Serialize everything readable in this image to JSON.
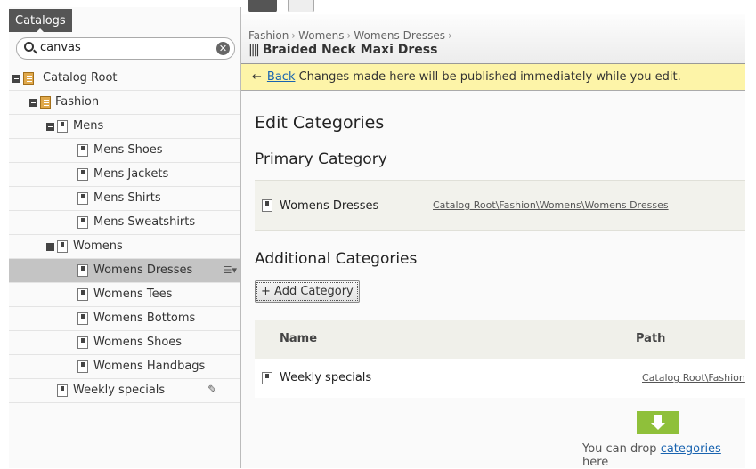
{
  "sidebar": {
    "tab": "Catalogs",
    "search": {
      "value": "canvas"
    },
    "tree": [
      {
        "label": "Catalog Root",
        "level": 0,
        "toggle": true,
        "icon": "catalog-book-icon"
      },
      {
        "label": "Fashion",
        "level": 1,
        "toggle": true,
        "icon": "catalog-book-icon"
      },
      {
        "label": "Mens",
        "level": 2,
        "toggle": true,
        "icon": "category-icon"
      },
      {
        "label": "Mens Shoes",
        "level": 3,
        "toggle": false,
        "icon": "category-icon"
      },
      {
        "label": "Mens Jackets",
        "level": 3,
        "toggle": false,
        "icon": "category-icon"
      },
      {
        "label": "Mens Shirts",
        "level": 3,
        "toggle": false,
        "icon": "category-icon"
      },
      {
        "label": "Mens Sweatshirts",
        "level": 3,
        "toggle": false,
        "icon": "category-icon"
      },
      {
        "label": "Womens",
        "level": 2,
        "toggle": true,
        "icon": "category-icon"
      },
      {
        "label": "Womens Dresses",
        "level": 3,
        "toggle": false,
        "icon": "category-icon",
        "selected": true,
        "action": "menu-icon"
      },
      {
        "label": "Womens Tees",
        "level": 3,
        "toggle": false,
        "icon": "category-icon"
      },
      {
        "label": "Womens Bottoms",
        "level": 3,
        "toggle": false,
        "icon": "category-icon"
      },
      {
        "label": "Womens Shoes",
        "level": 3,
        "toggle": false,
        "icon": "category-icon"
      },
      {
        "label": "Womens Handbags",
        "level": 3,
        "toggle": false,
        "icon": "category-icon"
      },
      {
        "label": "Weekly specials",
        "level": 2,
        "toggle": false,
        "icon": "category-icon",
        "action": "pencil-icon"
      }
    ]
  },
  "header": {
    "breadcrumb": [
      "Fashion",
      "Womens",
      "Womens Dresses"
    ],
    "title": "Braided Neck Maxi Dress"
  },
  "notice": {
    "back": "Back",
    "text": "Changes made here will be published immediately while you edit."
  },
  "main": {
    "title": "Edit Categories",
    "primary_heading": "Primary Category",
    "primary": {
      "name": "Womens Dresses",
      "path": "Catalog Root\\Fashion\\Womens\\Womens Dresses"
    },
    "additional_heading": "Additional Categories",
    "add_button": "Add Category",
    "columns": [
      "Name",
      "Path"
    ],
    "rows": [
      {
        "name": "Weekly specials",
        "path": "Catalog Root\\Fashion"
      }
    ],
    "drop": {
      "pre": "You can drop ",
      "link": "categories",
      "post": " here"
    }
  },
  "colors": {
    "notice_bg": "#fdf4a8",
    "drop_green": "#8fc03a",
    "link": "#1a64b0",
    "selected_row": "#c4c4c4"
  }
}
